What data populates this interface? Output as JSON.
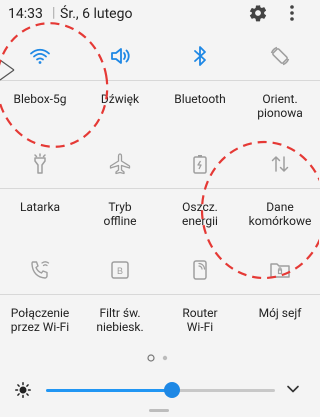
{
  "status": {
    "time": "14:33",
    "separator": "|",
    "date": "Śr., 6 lutego"
  },
  "tiles": [
    {
      "label": "Blebox-5g",
      "icon": "wifi-icon"
    },
    {
      "label": "Dźwięk",
      "icon": "sound-icon"
    },
    {
      "label": "Bluetooth",
      "icon": "bluetooth-icon"
    },
    {
      "label": "Orient.\npionowa",
      "icon": "rotation-icon"
    },
    {
      "label": "Latarka",
      "icon": "flashlight-icon"
    },
    {
      "label": "Tryb\noffline",
      "icon": "airplane-icon"
    },
    {
      "label": "Oszcz.\nenergii",
      "icon": "battery-saver-icon"
    },
    {
      "label": "Dane\nkomórkowe",
      "icon": "mobile-data-icon"
    },
    {
      "label": "Połączenie\nprzez Wi-Fi",
      "icon": "wifi-calling-icon"
    },
    {
      "label": "Filtr św.\nniebiesk.",
      "icon": "blue-light-filter-icon"
    },
    {
      "label": "Router\nWi-Fi",
      "icon": "hotspot-icon"
    },
    {
      "label": "Mój sejf",
      "icon": "secure-folder-icon"
    }
  ],
  "brightness": {
    "level": 0.51
  },
  "colors": {
    "active": "#1e88e5",
    "inactive": "#9e9e9e",
    "annotation": "#e53935"
  }
}
